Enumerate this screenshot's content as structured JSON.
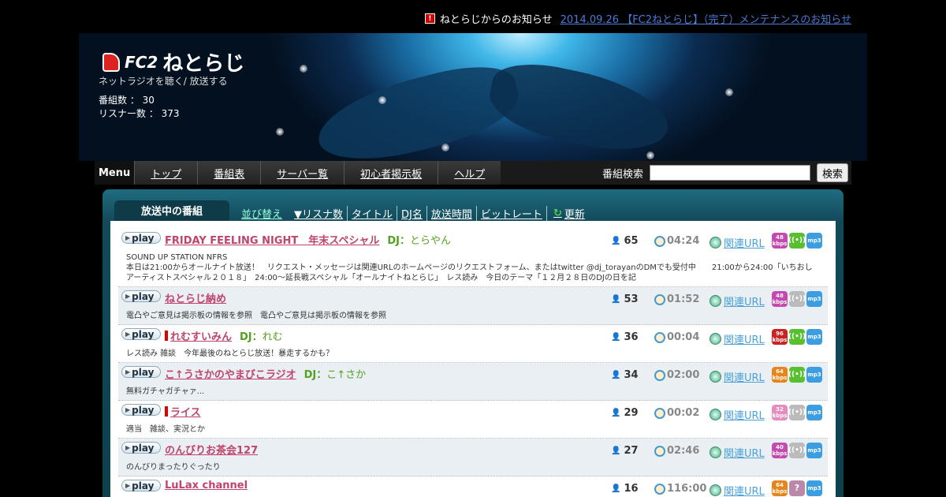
{
  "notice": {
    "label": "ねとらじからのお知らせ",
    "icon": "notice-icon",
    "link_text": "2014.09.26 【FC2ねとらじ】（完了）メンテナンスのお知らせ"
  },
  "header": {
    "logo_brand": "FC2",
    "logo_name": "ねとらじ",
    "tagline": "ネットラジオを聴く/ 放送する",
    "program_count_label": "番組数 ： 30",
    "listener_count_label": "リスナー数 ： 373"
  },
  "nav": {
    "menu_label": "Menu",
    "items": [
      "トップ",
      "番組表",
      "サーバー覧",
      "初心者掲示板",
      "ヘルプ"
    ],
    "search_label": "番組検索",
    "search_value": "",
    "search_button": "検索"
  },
  "tabs": {
    "active": "放送中の番組",
    "sort_label": "並び替え",
    "sort_items": [
      "▼リスナ数",
      "タイトル",
      "DJ名",
      "放送時間",
      "ビットレート"
    ],
    "refresh": "更新"
  },
  "programs": [
    {
      "title": "FRIDAY FEELING NIGHT　年末スペシャル",
      "dj": "DJ：",
      "dj_name": "とらやん",
      "listeners": "65",
      "time": "04:24",
      "link": "関連URL",
      "bitrate": "48",
      "live": true,
      "desc": "SOUND UP STATION NFRS\n本日は21:00からオールナイト放送！　リクエスト・メッセージは関連URLのホームページのリクエストフォーム、またはtwitter @dj_torayanのDMでも受付中　　21:00から24:00「いちおしアーティストスペシャル２０１８」　24:00～延長戦スペシャル「オールナイトねとらじ」　レス読み　今日のテーマ「１２月２８日のDJの日を記"
    },
    {
      "title": "ねとらじ納め",
      "dj": "",
      "dj_name": "",
      "listeners": "53",
      "time": "01:52",
      "link": "関連URL",
      "bitrate": "48",
      "live": false,
      "desc": "電凸やご意見は掲示板の情報を参照　電凸やご意見は掲示板の情報を参照"
    },
    {
      "title": "れむすいみん",
      "dj": "DJ：",
      "dj_name": "れむ",
      "listeners": "36",
      "time": "00:04",
      "link": "関連URL",
      "bitrate": "96",
      "live": true,
      "mark": true,
      "desc": "レス読み 雑談　今年最後のねとらじ放送！暴走するかも？"
    },
    {
      "title": "こ↑うさかのやまびこラジオ",
      "dj": "DJ：",
      "dj_name": "こ↑さか",
      "listeners": "34",
      "time": "02:00",
      "link": "関連URL",
      "bitrate": "64",
      "live": true,
      "desc": "無料ガチャガチャァ..."
    },
    {
      "title": "ライス",
      "dj": "",
      "dj_name": "",
      "listeners": "29",
      "time": "00:02",
      "link": "関連URL",
      "bitrate": "32",
      "live": false,
      "mark": true,
      "desc": "適当　雑談、実況とか"
    },
    {
      "title": "のんびりお茶会127",
      "dj": "",
      "dj_name": "",
      "listeners": "27",
      "time": "02:46",
      "link": "関連URL",
      "bitrate": "40",
      "live": false,
      "desc": "のんびりまったりぐったり"
    },
    {
      "title": "LuLax channel",
      "dj": "",
      "dj_name": "",
      "listeners": "16",
      "time": "116:00",
      "link": "関連URL",
      "bitrate": "64",
      "live": null,
      "desc": ""
    }
  ],
  "labels": {
    "play": "play",
    "kbps": "kbps",
    "mp3": "mp3",
    "unknown": "?"
  }
}
